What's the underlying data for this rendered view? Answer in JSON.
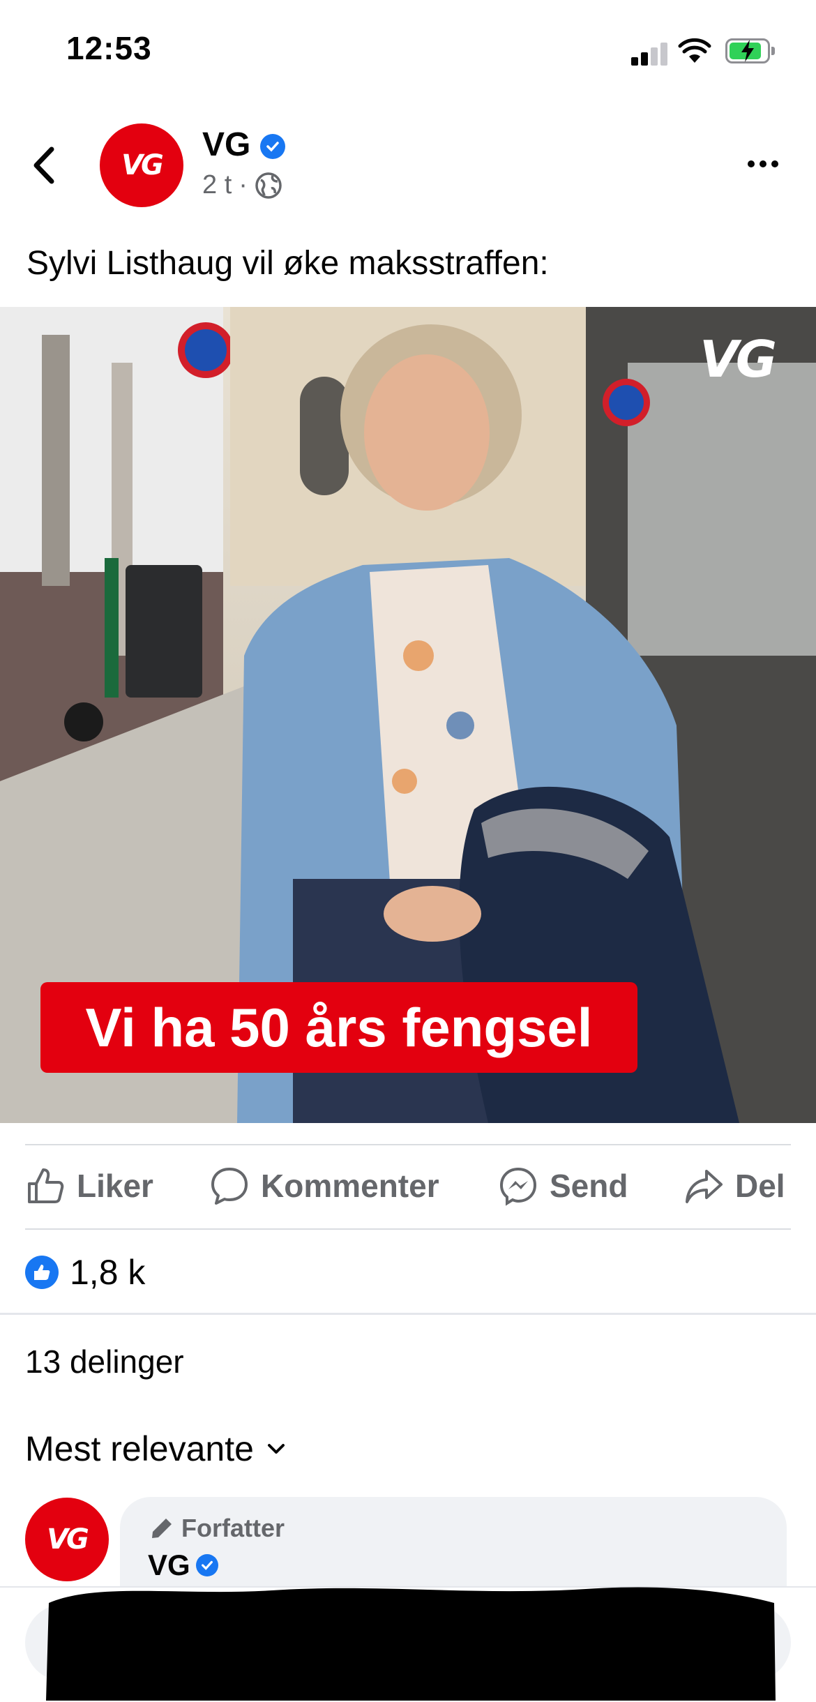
{
  "status_bar": {
    "time": "12:53",
    "battery_color": "#30d158"
  },
  "post": {
    "page_name": "VG",
    "avatar_text": "VG",
    "timestamp": "2 t",
    "separator": "·",
    "audience_icon": "globe-icon",
    "caption": "Sylvi Listhaug vil øke maksstraffen:",
    "image": {
      "watermark": "VG",
      "headline": "Vi ha 50 års fengsel"
    }
  },
  "actions": {
    "like": "Liker",
    "comment": "Kommenter",
    "send": "Send",
    "share": "Del"
  },
  "reactions": {
    "count": "1,8 k"
  },
  "shares": "13 delinger",
  "sort": {
    "label": "Mest relevante"
  },
  "comment": {
    "avatar_text": "VG",
    "badge": "Forfatter",
    "name": "VG"
  },
  "colors": {
    "brand": "#e3000f",
    "facebook_blue": "#1877f2"
  }
}
